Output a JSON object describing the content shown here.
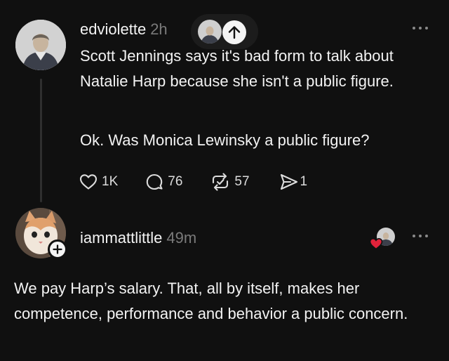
{
  "post": {
    "username": "edviolette",
    "time": "2h",
    "paragraphs": [
      "Scott Jennings says it's bad form to talk about Natalie Harp because she isn't a public figure.",
      "Ok.  Was Monica Lewinsky a public figure?"
    ],
    "actions": {
      "likes": "1K",
      "replies": "76",
      "reposts": "57",
      "shares": "1"
    }
  },
  "reply": {
    "username": "iammattlittle",
    "time": "49m",
    "text": "We pay Harp’s salary. That, all by itself, makes her competence, performance and behavior a public concern."
  },
  "icons": {
    "more": "more-dots-icon",
    "like": "heart-icon",
    "reply": "comment-icon",
    "repost": "repost-icon",
    "share": "send-icon",
    "scroll_up": "arrow-up-icon",
    "follow": "plus-icon",
    "liked_by_author": "red-heart-icon"
  },
  "colors": {
    "background": "#101010",
    "text": "#f3f3f3",
    "muted": "#7a7a7a",
    "liked_heart": "#e0223a"
  }
}
